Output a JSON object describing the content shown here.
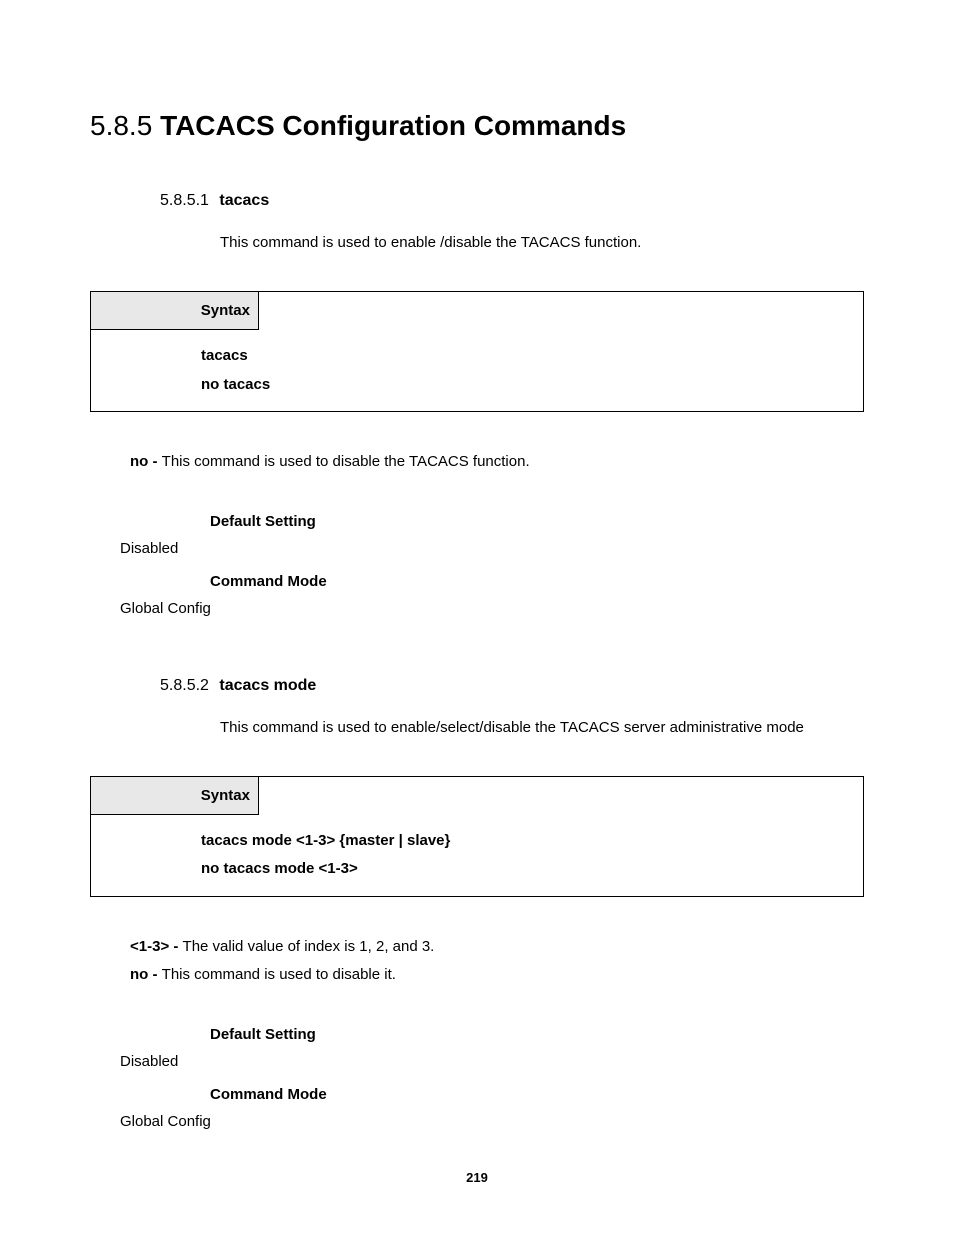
{
  "section": {
    "number": "5.8.5",
    "title": "TACACS Configuration Commands"
  },
  "sub": [
    {
      "number": "5.8.5.1",
      "title": "tacacs",
      "desc": "This command is used to enable /disable the TACACS function.",
      "syntax_label": "Syntax",
      "syntax_lines": [
        "tacacs",
        "no tacacs"
      ],
      "params": [
        {
          "key": "no - ",
          "text": "This command is used to disable the TACACS function."
        }
      ],
      "settings": [
        {
          "label": "Default Setting",
          "value": "Disabled"
        },
        {
          "label": "Command Mode",
          "value": "Global Config"
        }
      ]
    },
    {
      "number": "5.8.5.2",
      "title": "tacacs mode",
      "desc": "This command is used to enable/select/disable the TACACS server administrative mode",
      "syntax_label": "Syntax",
      "syntax_lines": [
        "tacacs mode <1-3> {master | slave}",
        "no tacacs mode <1-3>"
      ],
      "params": [
        {
          "key": "<1-3> - ",
          "text": "The valid value of index is 1, 2, and 3."
        },
        {
          "key": "no - ",
          "text": "This command is used to disable it."
        }
      ],
      "settings": [
        {
          "label": "Default Setting",
          "value": "Disabled"
        },
        {
          "label": "Command Mode",
          "value": "Global Config"
        }
      ]
    }
  ],
  "page_number": "219"
}
